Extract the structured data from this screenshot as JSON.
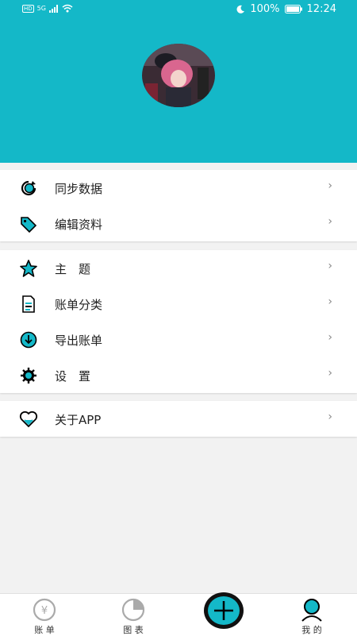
{
  "colors": {
    "accent": "#14b8c8"
  },
  "status_bar": {
    "hd": "HD",
    "network": "5G",
    "battery": "100%",
    "time": "12:24"
  },
  "menu_group_1": [
    {
      "label": "同步数据",
      "icon": "sync-icon"
    },
    {
      "label": "编辑资料",
      "icon": "tag-icon"
    }
  ],
  "menu_group_2": [
    {
      "label": "主　题",
      "icon": "star-icon"
    },
    {
      "label": "账单分类",
      "icon": "document-icon"
    },
    {
      "label": "导出账单",
      "icon": "download-icon"
    },
    {
      "label": "设　置",
      "icon": "gear-icon"
    }
  ],
  "menu_group_3": [
    {
      "label": "关于APP",
      "icon": "heart-icon"
    }
  ],
  "tabbar": {
    "bill": "账 单",
    "chart": "图 表",
    "mine": "我 的"
  }
}
